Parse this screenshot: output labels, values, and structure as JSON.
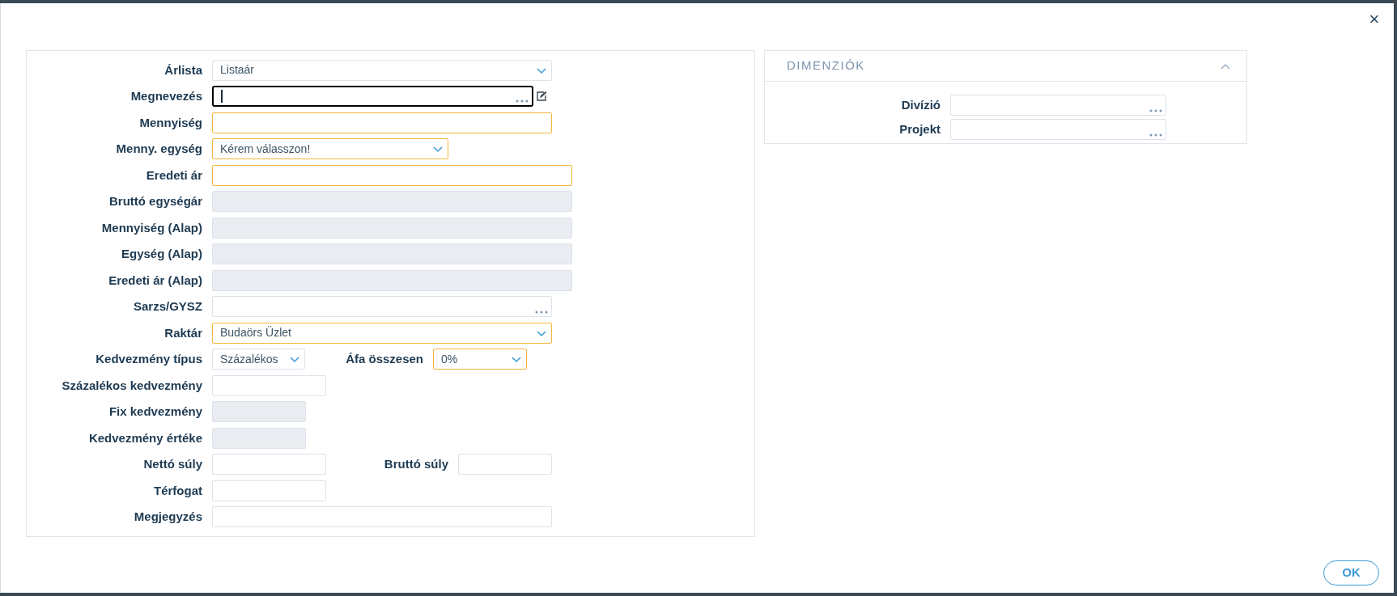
{
  "dialog": {
    "close": "×",
    "ok_button": "OK"
  },
  "form": {
    "rows": [
      {
        "label": "Árlista",
        "field": {
          "kind": "select",
          "value": "Listaár",
          "required": false
        }
      },
      {
        "label": "Megnevezés",
        "field": {
          "kind": "lookup",
          "focused": true,
          "edit": true
        }
      },
      {
        "label": "Mennyiség",
        "field": {
          "kind": "text",
          "required": true
        }
      },
      {
        "label": "Menny. egység",
        "field": {
          "kind": "select",
          "value": "Kérem válasszon!",
          "required": true
        }
      },
      {
        "label": "Eredeti ár",
        "field": {
          "kind": "text",
          "required": true
        }
      },
      {
        "label": "Bruttó egységár",
        "field": {
          "kind": "readonly",
          "required": false
        }
      },
      {
        "label": "Mennyiség (Alap)",
        "field": {
          "kind": "readonly",
          "required": false
        }
      },
      {
        "label": "Egység (Alap)",
        "field": {
          "kind": "readonly",
          "required": false
        }
      },
      {
        "label": "Eredeti ár (Alap)",
        "field": {
          "kind": "readonly",
          "required": false
        }
      },
      {
        "label": "Sarzs/GYSZ",
        "field": {
          "kind": "lookup",
          "required": false
        }
      },
      {
        "label": "Raktár",
        "field": {
          "kind": "select",
          "value": "Budaörs Üzlet",
          "required": true
        }
      },
      {
        "label": "Kedvezmény típus",
        "field": {
          "kind": "select",
          "value": "Százalékos",
          "required": false
        },
        "extra": {
          "label": "Áfa összesen",
          "field": {
            "kind": "select",
            "value": "0%",
            "required": true
          }
        }
      },
      {
        "label": "Százalékos kedvezmény",
        "field": {
          "kind": "text",
          "required": false
        }
      },
      {
        "label": "Fix kedvezmény",
        "field": {
          "kind": "readonly",
          "required": false
        }
      },
      {
        "label": "Kedvezmény értéke",
        "field": {
          "kind": "readonly",
          "required": false
        }
      },
      {
        "label": "Nettó súly",
        "field": {
          "kind": "text",
          "required": false
        },
        "extra": {
          "label": "Bruttó súly",
          "field": {
            "kind": "text",
            "required": false
          }
        }
      },
      {
        "label": "Térfogat",
        "field": {
          "kind": "text",
          "required": false
        }
      },
      {
        "label": "Megjegyzés",
        "field": {
          "kind": "text",
          "required": false
        }
      }
    ]
  },
  "dimensions": {
    "title": "DIMENZIÓK",
    "expanded": true,
    "rows": [
      {
        "label": "Divízió",
        "field": {
          "kind": "lookup",
          "required": false
        }
      },
      {
        "label": "Projekt",
        "field": {
          "kind": "lookup",
          "required": false
        }
      }
    ]
  }
}
